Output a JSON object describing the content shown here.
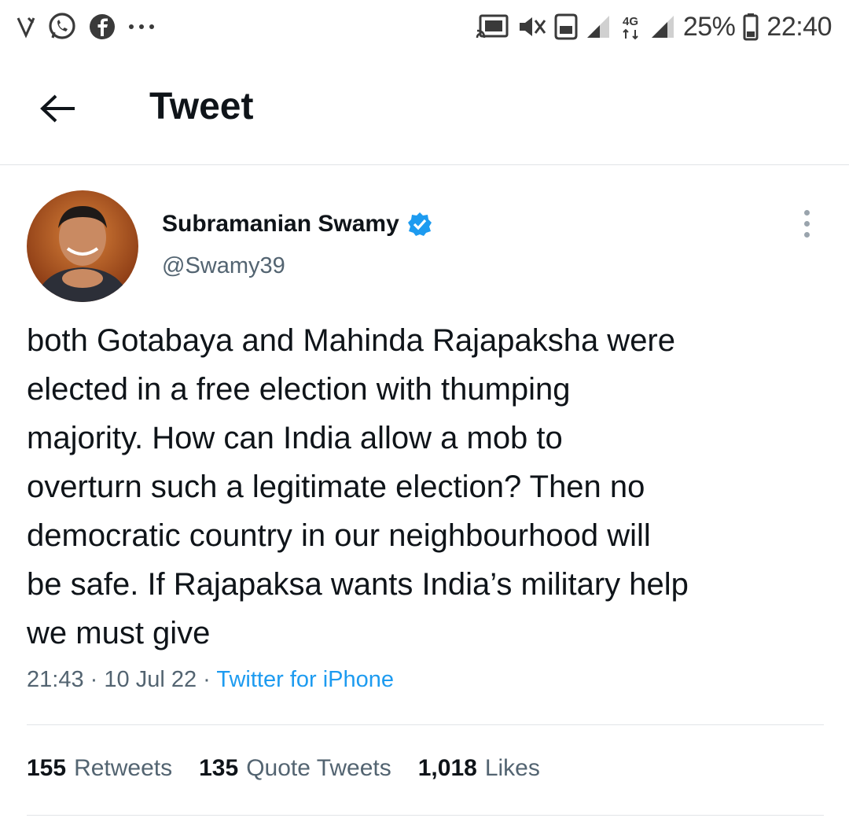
{
  "status_bar": {
    "left_icons": [
      "v-notification-icon",
      "whatsapp-icon",
      "facebook-icon",
      "more-notifications-icon"
    ],
    "right_icons": [
      "cast-icon",
      "mute-icon",
      "hd-icon",
      "signal-icon",
      "4g-icon",
      "signal-icon-2",
      "battery-icon"
    ],
    "network": "4G",
    "battery": "25%",
    "time": "22:40"
  },
  "header": {
    "title": "Tweet",
    "back_icon": "back-arrow-icon"
  },
  "tweet": {
    "author_name": "Subramanian Swamy",
    "verified_icon": "verified-badge-icon",
    "handle": "@Swamy39",
    "more_icon": "more-vertical-icon",
    "text": "both Gotabaya and Mahinda Rajapaksha were\nelected in a free election with thumping\nmajority. How can India allow a mob to\noverturn such a  legitimate election? Then no\ndemocratic country in our neighbourhood will\nbe safe. If Rajapaksa wants India’s military help\nwe must give",
    "time": "21:43",
    "date": "10 Jul 22",
    "separator": "·",
    "source": "Twitter for iPhone",
    "colors": {
      "link": "#1d9bf0",
      "secondary": "#536471",
      "primary": "#0f1419"
    }
  },
  "stats": {
    "retweets_count": "155",
    "retweets_label": "Retweets",
    "quotes_count": "135",
    "quotes_label": "Quote Tweets",
    "likes_count": "1,018",
    "likes_label": "Likes"
  }
}
